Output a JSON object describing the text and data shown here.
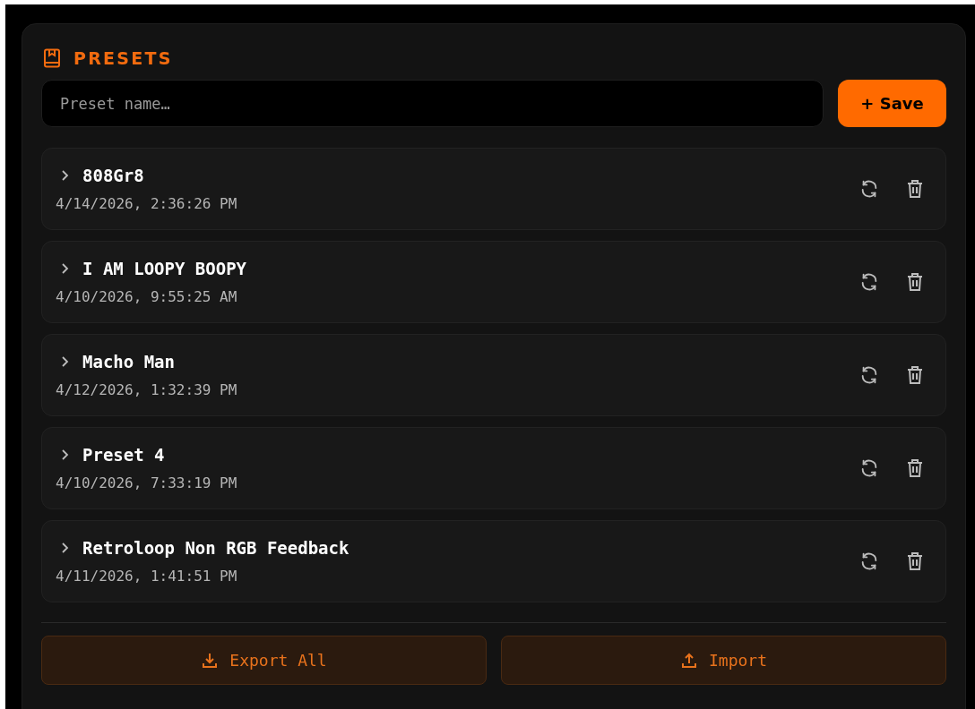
{
  "header": {
    "title": "PRESETS"
  },
  "name_field": {
    "placeholder": "Preset name…"
  },
  "save_button": {
    "label": "+ Save"
  },
  "presets": [
    {
      "name": "808Gr8",
      "timestamp": "4/14/2026, 2:36:26 PM",
      "expanded": false
    },
    {
      "name": "I AM LOOPY BOOPY",
      "timestamp": "4/10/2026, 9:55:25 AM",
      "expanded": false
    },
    {
      "name": "Macho Man",
      "timestamp": "4/12/2026, 1:32:39 PM",
      "expanded": false
    },
    {
      "name": "Preset 4",
      "timestamp": "4/10/2026, 7:33:19 PM",
      "expanded": false
    },
    {
      "name": "Retroloop Non RGB Feedback",
      "timestamp": "4/11/2026, 1:41:51 PM",
      "expanded": false
    }
  ],
  "footer_buttons": [
    {
      "label": "Export All",
      "kind": "export"
    },
    {
      "label": "Import",
      "kind": "import"
    }
  ]
}
